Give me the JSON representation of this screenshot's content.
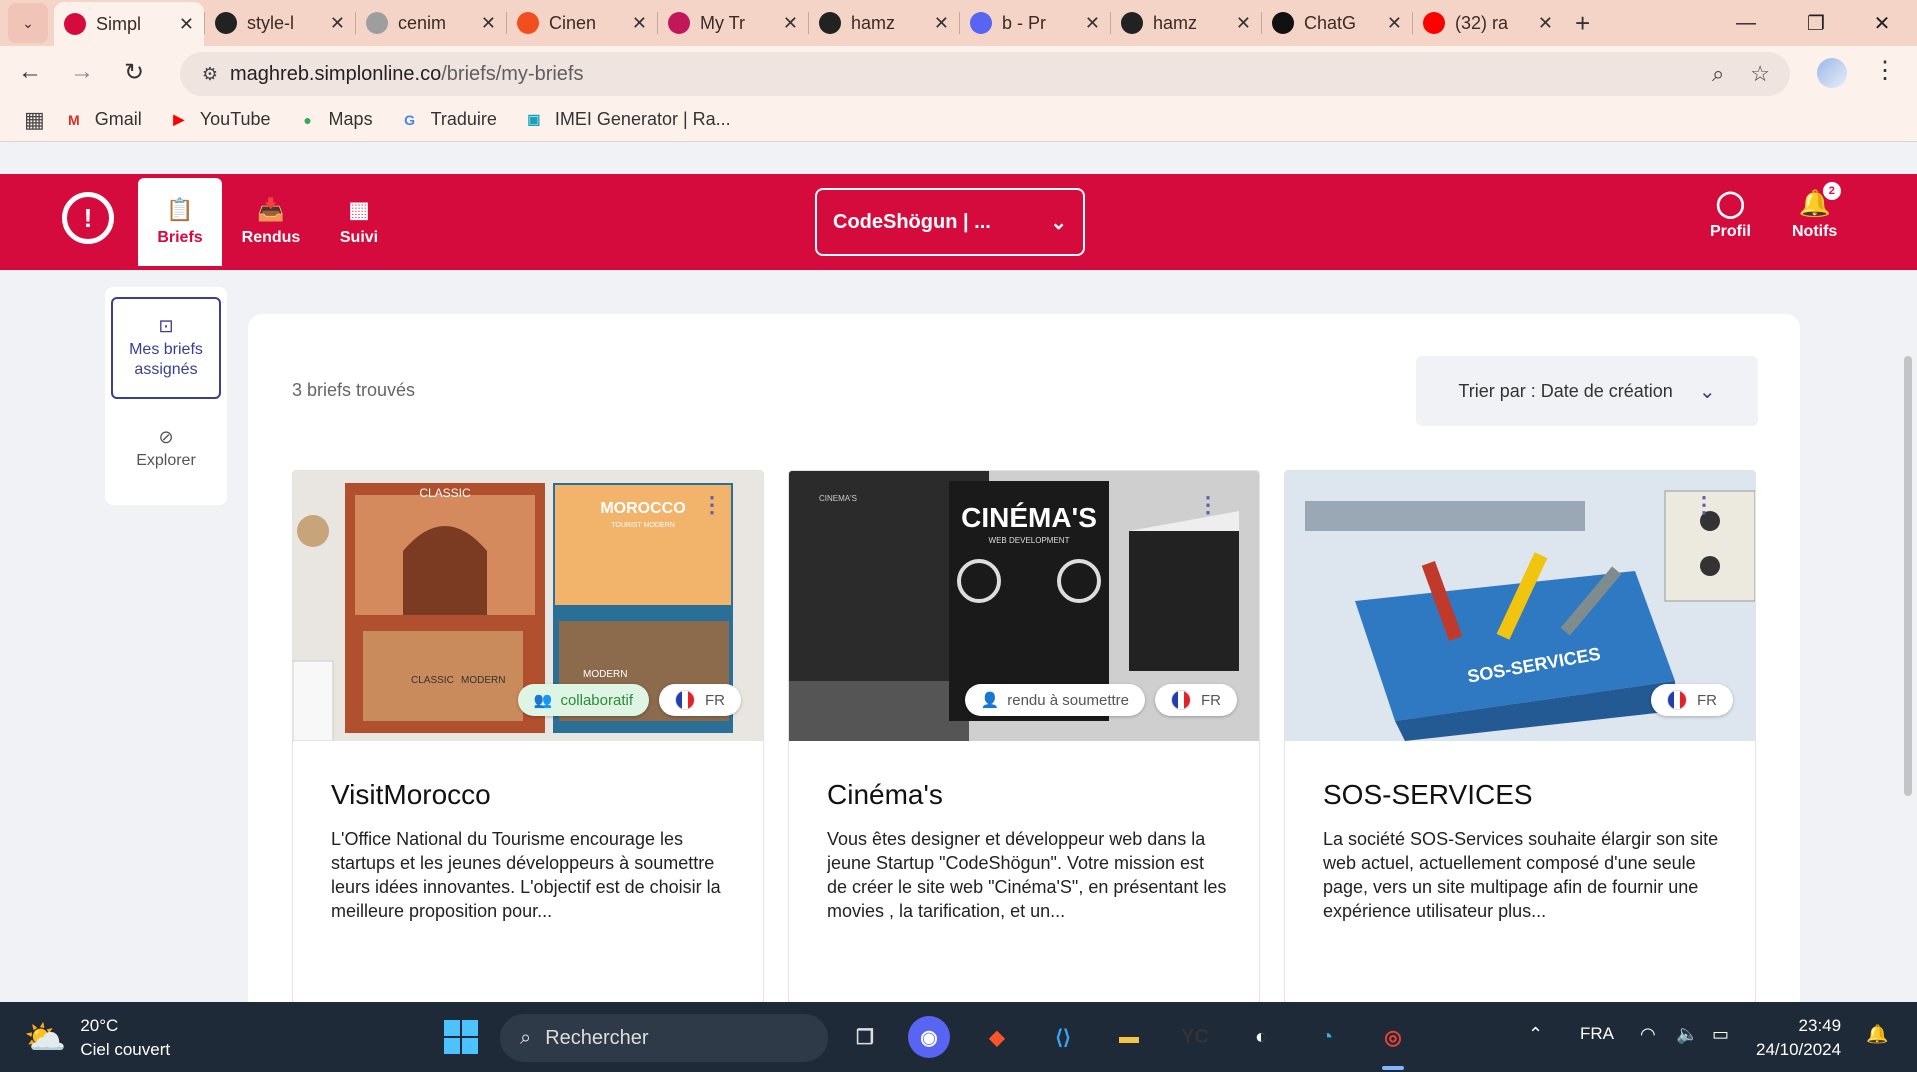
{
  "browser": {
    "tabs": [
      {
        "label": "Simpl",
        "favicon": "simplon-icon",
        "color": "#d60b3d",
        "active": true
      },
      {
        "label": "style-l",
        "favicon": "github-icon",
        "color": "#222222"
      },
      {
        "label": "cenim",
        "favicon": "globe-icon",
        "color": "#9e9e9e"
      },
      {
        "label": "Cinen",
        "favicon": "figma-icon",
        "color": "#f24e1e"
      },
      {
        "label": "My Tr",
        "favicon": "trello-icon",
        "color": "#c2185b"
      },
      {
        "label": "hamz",
        "favicon": "github-icon",
        "color": "#222222"
      },
      {
        "label": "b - Pr",
        "favicon": "chat-icon",
        "color": "#5865f2"
      },
      {
        "label": "hamz",
        "favicon": "github-icon",
        "color": "#222222"
      },
      {
        "label": "ChatG",
        "favicon": "openai-icon",
        "color": "#111111"
      },
      {
        "label": "(32) ra",
        "favicon": "youtube-icon",
        "color": "#ff0000"
      }
    ],
    "url_host": "maghreb.simplonline.co",
    "url_path": "/briefs/my-briefs",
    "bookmarks": [
      {
        "label": "Gmail",
        "icon": "M",
        "color": "#d93025"
      },
      {
        "label": "YouTube",
        "icon": "▶",
        "color": "#ff0000"
      },
      {
        "label": "Maps",
        "icon": "●",
        "color": "#34a853"
      },
      {
        "label": "Traduire",
        "icon": "G",
        "color": "#4285f4"
      },
      {
        "label": "IMEI Generator | Ra...",
        "icon": "▣",
        "color": "#1aa3b8"
      }
    ]
  },
  "app": {
    "nav": {
      "briefs": "Briefs",
      "rendus": "Rendus",
      "suivi": "Suivi"
    },
    "selector": "CodeShögun | ...",
    "profile": "Profil",
    "notifs": "Notifs",
    "notif_count": "2",
    "brand_color": "#d60b3d"
  },
  "sidebar": {
    "assigned": "Mes briefs assignés",
    "explore": "Explorer"
  },
  "main": {
    "found": "3 briefs trouvés",
    "sort": "Trier par : Date de création",
    "cards": [
      {
        "title": "VisitMorocco",
        "desc": "L'Office National du Tourisme encourage les startups et les jeunes développeurs à soumettre leurs idées innovantes. L'objectif est de choisir la meilleure proposition pour...",
        "tag": "collaboratif",
        "lang": "FR"
      },
      {
        "title": "Cinéma's",
        "desc": "Vous êtes designer et développeur web dans la jeune Startup \"CodeShögun\". Votre mission est de créer le site web \"Cinéma'S\", en présentant les movies , la tarification, et un...",
        "tag": "rendu à soumettre",
        "lang": "FR"
      },
      {
        "title": "SOS-SERVICES",
        "desc": "La société SOS-Services souhaite élargir son site web actuel, actuellement composé d'une seule page, vers un site multipage afin de fournir une expérience utilisateur plus...",
        "lang": "FR"
      }
    ],
    "image_text": {
      "morocco_classic": "CLASSIC",
      "morocco_title": "MOROCCO",
      "morocco_sub": "TOURIST MODERN",
      "morocco_classic2": "CLASSIC",
      "morocco_modern": "MODERN",
      "morocco_modern2": "MODERN",
      "cinema_title": "CINÉMA'S",
      "cinema_sub": "WEB DEVELOPMENT",
      "cinema_small": "CINEMA'S",
      "sos_badge": "SOS-SERVICES"
    }
  },
  "taskbar": {
    "temp": "20°C",
    "weather": "Ciel couvert",
    "search": "Rechercher",
    "lang": "FRA",
    "time": "23:49",
    "date": "24/10/2024"
  }
}
